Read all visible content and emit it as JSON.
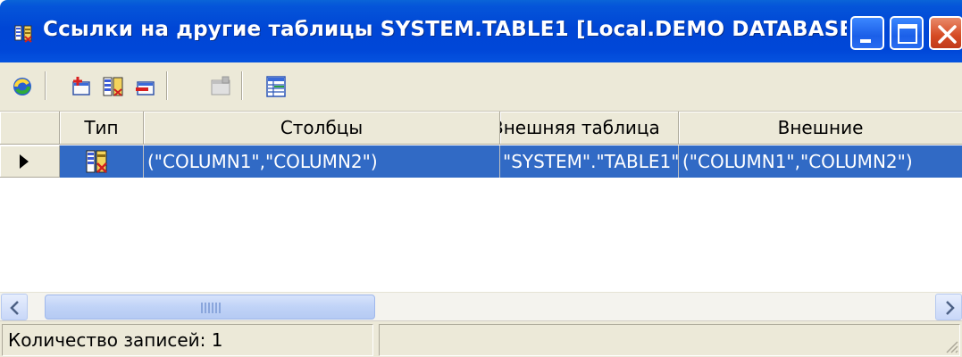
{
  "window": {
    "title": "Ссылки на другие таблицы SYSTEM.TABLE1 [Local.DEMO DATABASE...",
    "title_icon": "table-links-icon",
    "buttons": [
      "minimize-icon",
      "maximize-icon",
      "close-icon"
    ]
  },
  "toolbar": {
    "tools": [
      {
        "name": "refresh-button",
        "icon": "refresh-icon"
      },
      {
        "name": "add-reference-button",
        "icon": "add-icon"
      },
      {
        "name": "edit-reference-button",
        "icon": "edit-icon"
      },
      {
        "name": "delete-reference-button",
        "icon": "delete-icon"
      },
      {
        "name": "properties-button",
        "icon": "properties-icon",
        "disabled": true
      },
      {
        "name": "grid-view-button",
        "icon": "grid-icon"
      }
    ]
  },
  "grid": {
    "headers": {
      "type": "Тип",
      "columns": "Столбцы",
      "foreign_table": "Внешняя таблица",
      "foreign": "Внешние"
    },
    "rows": [
      {
        "indicator": "current-row-icon",
        "type_icon": "foreign-key-icon",
        "columns": "(\"COLUMN1\",\"COLUMN2\")",
        "foreign_table": "\"SYSTEM\".\"TABLE1\"",
        "foreign": "(\"COLUMN1\",\"COLUMN2\")"
      }
    ]
  },
  "statusbar": {
    "record_count": "Количество записей: 1",
    "secondary": ""
  },
  "colors": {
    "titlebar": "#0046d5",
    "selection": "#316ac5",
    "chrome": "#ece9d8"
  }
}
